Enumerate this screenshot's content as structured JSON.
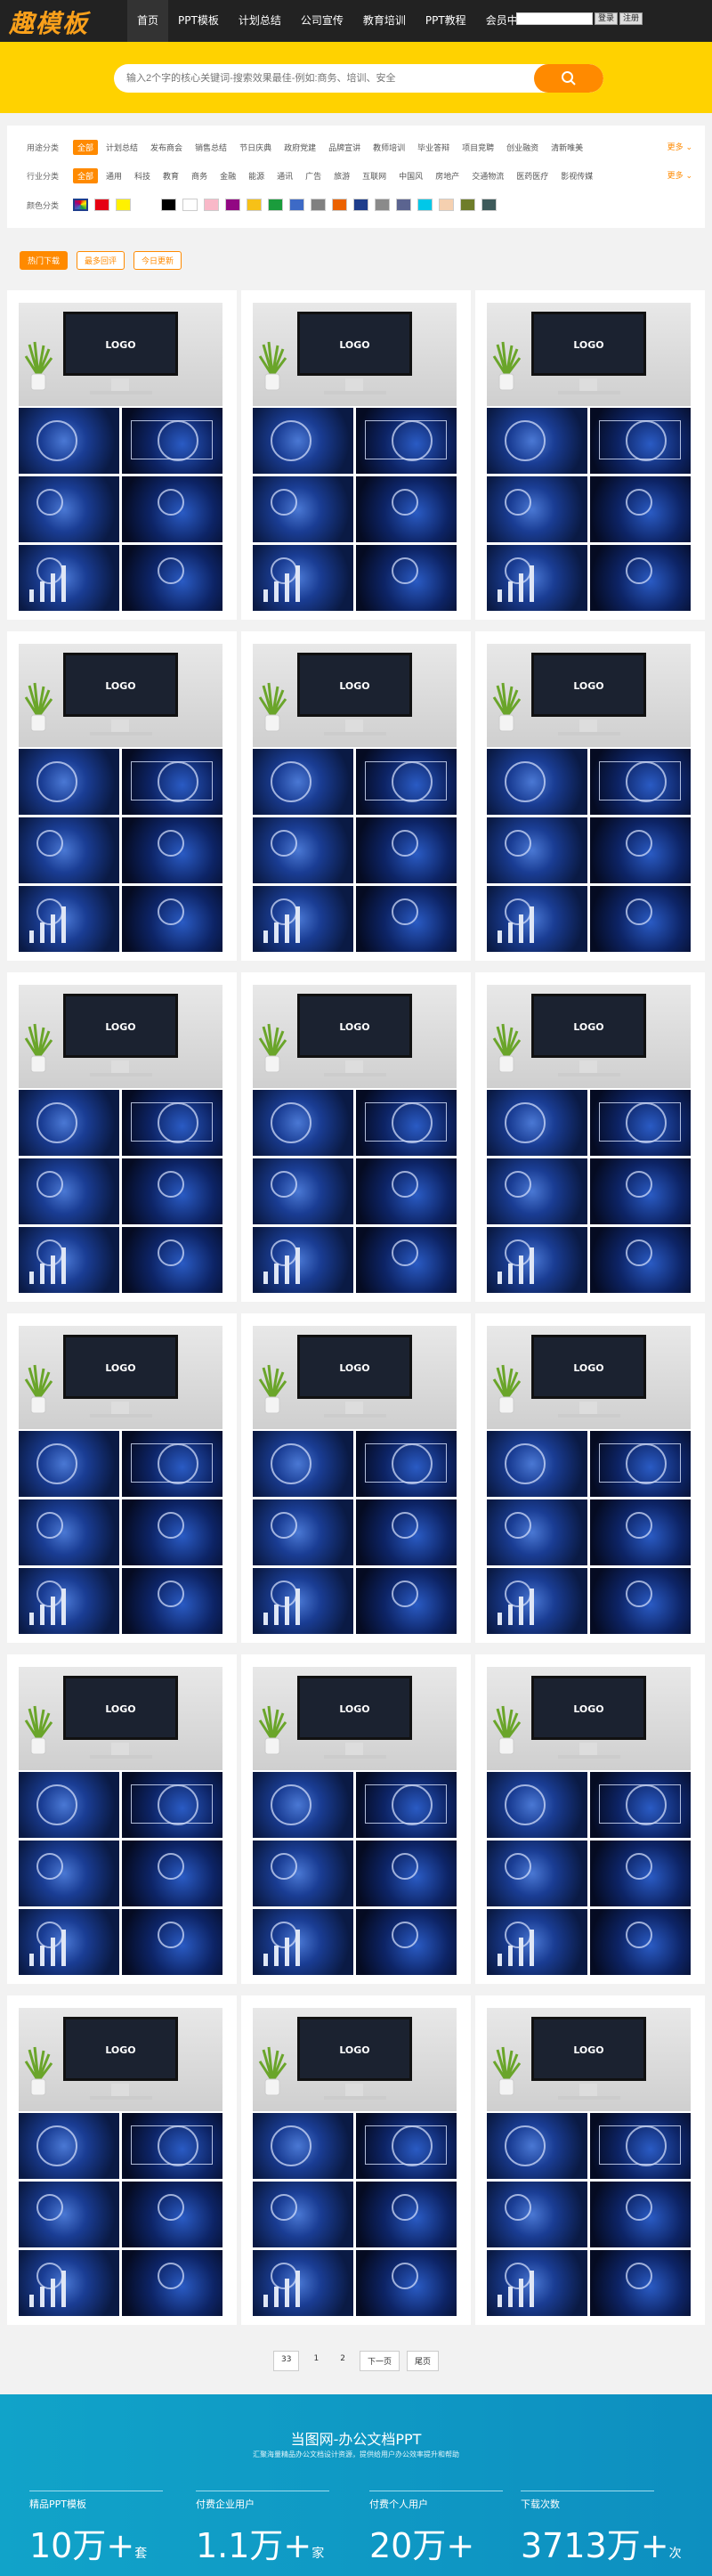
{
  "header": {
    "logo": "趣模板",
    "nav": [
      "首页",
      "PPT模板",
      "计划总结",
      "公司宣传",
      "教育培训",
      "PPT教程",
      "会员中心"
    ],
    "login": "登录",
    "register": "注册"
  },
  "search": {
    "placeholder": "输入2个字的核心关键词-搜索效果最佳-例如:商务、培训、安全"
  },
  "filters": {
    "use_label": "用途分类",
    "use_items": [
      "全部",
      "计划总结",
      "发布商会",
      "销售总结",
      "节日庆典",
      "政府党建",
      "品牌宣讲",
      "教师培训",
      "毕业答辩",
      "项目竞聘",
      "创业融资",
      "清新唯美"
    ],
    "industry_label": "行业分类",
    "industry_items": [
      "全部",
      "通用",
      "科技",
      "教育",
      "商务",
      "金融",
      "能源",
      "通讯",
      "广告",
      "旅游",
      "互联网",
      "中国风",
      "房地产",
      "交通物流",
      "医药医疗",
      "影视传媒"
    ],
    "color_label": "颜色分类",
    "more": "更多",
    "colors": [
      "#ffffff",
      "#e60012",
      "#fff100",
      "#ffffff",
      "#000000",
      "#ffffff",
      "#f9b8c8",
      "#920783",
      "#f7c117",
      "#1a9c3c",
      "#3d6ac6",
      "#808080",
      "#eb6100",
      "#1e3d8c",
      "#8a8a8a",
      "#5b6490",
      "#00c8e8",
      "#f5d0b0",
      "#6e7d2a",
      "#3d5a5a"
    ]
  },
  "tabs": [
    "热门下载",
    "最多回评",
    "今日更新"
  ],
  "cards": {
    "logo_text": "LOGO",
    "count": 18
  },
  "pagination": {
    "items": [
      "33",
      "1",
      "2",
      "下一页",
      "尾页"
    ]
  },
  "footer": {
    "title": "当图网-办公文档PPT",
    "subtitle": "汇聚海量精品办公文档设计资源，提供给用户办公效率提升和帮助",
    "stats": [
      {
        "label": "精品PPT模板",
        "value": "10万+",
        "unit": "套"
      },
      {
        "label": "付费企业用户",
        "value": "1.1万+",
        "unit": "家"
      },
      {
        "label": "付费个人用户",
        "value": "20万+",
        "unit": ""
      },
      {
        "label": "下载次数",
        "value": "3713万+",
        "unit": "次"
      }
    ]
  }
}
